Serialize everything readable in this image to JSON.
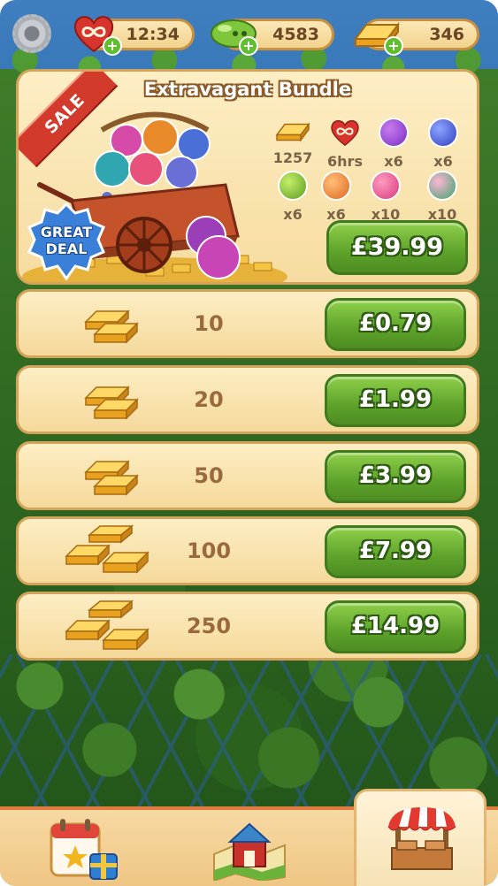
{
  "hud": {
    "settings_icon": "gear-icon",
    "lives": {
      "icon": "infinite-heart-icon",
      "value": "12:34"
    },
    "beans": {
      "icon": "green-bean-icon",
      "value": "4583"
    },
    "gold": {
      "icon": "gold-bar-icon",
      "value": "346"
    }
  },
  "bundle": {
    "sale_label": "SALE",
    "title": "Extravagant Bundle",
    "badge": "GREAT\nDEAL",
    "badge_line1": "GREAT",
    "badge_line2": "DEAL",
    "rewards": [
      {
        "icon": "gold-bar-icon",
        "count": "1257"
      },
      {
        "icon": "infinite-heart-icon",
        "count": "6hrs"
      },
      {
        "icon": "purple-booster-icon",
        "count": "x6"
      },
      {
        "icon": "blue-booster-icon",
        "count": "x6"
      },
      {
        "icon": "plus-one-booster-icon",
        "count": "x6"
      },
      {
        "icon": "orange-booster-icon",
        "count": "x6"
      },
      {
        "icon": "pink-flower-booster-icon",
        "count": "x10"
      },
      {
        "icon": "pink-green-booster-icon",
        "count": "x10"
      }
    ],
    "price": "£39.99"
  },
  "packs": [
    {
      "amount": "10",
      "price": "£0.79"
    },
    {
      "amount": "20",
      "price": "£1.99"
    },
    {
      "amount": "50",
      "price": "£3.99"
    },
    {
      "amount": "100",
      "price": "£7.99"
    },
    {
      "amount": "250",
      "price": "£14.99"
    }
  ],
  "nav": {
    "tabs": [
      {
        "icon": "calendar-gift-icon",
        "active": false
      },
      {
        "icon": "farm-map-icon",
        "active": false
      },
      {
        "icon": "shop-stall-icon",
        "active": true
      }
    ]
  },
  "colors": {
    "accent_green": "#5da22a",
    "panel": "#fdeec4",
    "panel_border": "#d4a25a",
    "sale_red": "#d23a2b"
  }
}
